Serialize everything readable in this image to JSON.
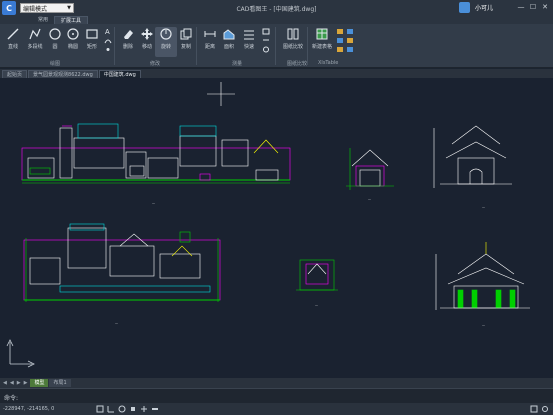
{
  "titlebar": {
    "logo_letter": "C",
    "mode": "编辑模式",
    "title": "CAD看图王 - [中国建筑.dwg]",
    "username": "小可儿",
    "min": "—",
    "max": "☐",
    "close": "✕"
  },
  "ribbon_tabs": [
    "常用",
    "扩展工具"
  ],
  "tools": {
    "line": "直线",
    "polyline": "多段线",
    "circle": "圆",
    "ellipse": "椭圆",
    "rect": "矩形",
    "text": "文字",
    "delete": "删除",
    "move": "移动",
    "rotate": "旋转",
    "copy": "复制",
    "dist": "距离",
    "area": "面积",
    "quick": "快速",
    "compare": "图纸比较",
    "newtable": "新建表格"
  },
  "groups": {
    "draw": "绘图",
    "modify": "修改",
    "measure": "测量",
    "compare": "图纸比较",
    "xtable": "XlsTable"
  },
  "doc_tabs": [
    "起始页",
    "景气园景观观测8622.dwg",
    "中国建筑.dwg"
  ],
  "active_doc_tab": 2,
  "layout_tabs": [
    "模型",
    "布局1"
  ],
  "command_prompt": "命令:",
  "coords": "-228947, -214165, 0",
  "colors": {
    "background": "#1a2230",
    "ribbon": "#323c49",
    "accent_green": "#00d000",
    "accent_magenta": "#ff00ff",
    "accent_cyan": "#00e0e0",
    "accent_yellow": "#ffff00"
  }
}
